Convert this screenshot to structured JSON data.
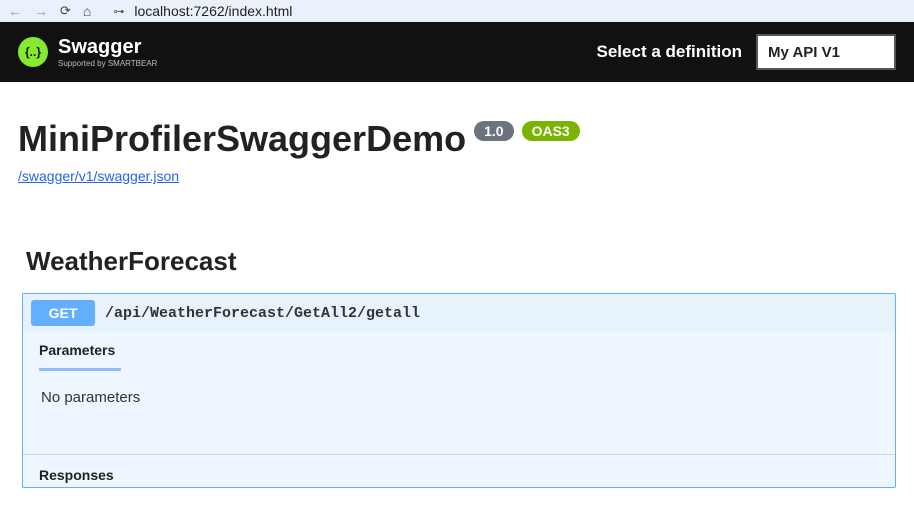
{
  "browser": {
    "url": "localhost:7262/index.html"
  },
  "topbar": {
    "brand_name": "Swagger",
    "brand_sub": "Supported by SMARTBEAR",
    "select_label": "Select a definition",
    "definition_value": "My API V1"
  },
  "api": {
    "title": "MiniProfilerSwaggerDemo",
    "version": "1.0",
    "oas": "OAS3",
    "json_url": "/swagger/v1/swagger.json"
  },
  "tag": {
    "name": "WeatherForecast"
  },
  "operation": {
    "method": "GET",
    "path": "/api/WeatherForecast/GetAll2/getall",
    "parameters_heading": "Parameters",
    "no_parameters": "No parameters",
    "responses_heading": "Responses"
  }
}
